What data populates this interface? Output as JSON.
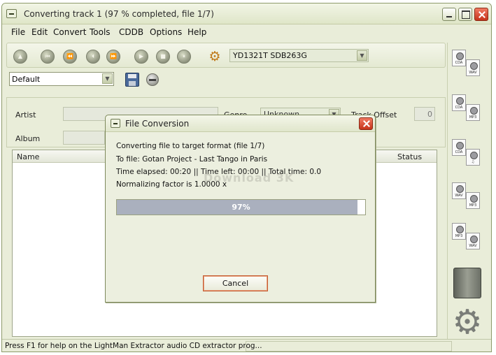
{
  "window": {
    "title": "Converting track 1 (97 % completed, file 1/7)"
  },
  "menu": [
    {
      "label": "File"
    },
    {
      "label": "Edit"
    },
    {
      "label": "Convert"
    },
    {
      "label": "Tools"
    },
    {
      "label": "CDDB"
    },
    {
      "label": "Options"
    },
    {
      "label": "Help"
    }
  ],
  "toolbar": {
    "buttons": [
      {
        "name": "eject-icon",
        "glyph": "▲"
      },
      {
        "name": "previous-track-icon",
        "glyph": "⏮"
      },
      {
        "name": "rewind-icon",
        "glyph": "⏪"
      },
      {
        "name": "skip-back-icon",
        "glyph": "⏴"
      },
      {
        "name": "fast-forward-icon",
        "glyph": "⏩"
      },
      {
        "name": "play-icon",
        "glyph": "▶"
      },
      {
        "name": "stop-icon",
        "glyph": "■"
      },
      {
        "name": "pause-icon",
        "glyph": "⏸"
      }
    ],
    "settings_glyph": "⚙",
    "drive": "YD1321T SDB263G"
  },
  "preset": {
    "value": "Default"
  },
  "info": {
    "artist_label": "Artist",
    "album_label": "Album",
    "genre_label": "Genre",
    "genre_value": "Unknown",
    "track_offset_label": "Track Offset",
    "track_offset_value": "0"
  },
  "track_list": {
    "columns": {
      "name": "Name",
      "status": "Status"
    }
  },
  "right_panel": {
    "conversions": [
      {
        "from": "CDA",
        "to": "WAV"
      },
      {
        "from": "CDA",
        "to": "MP3"
      },
      {
        "from": "CDA",
        "to": "♫"
      },
      {
        "from": "WAV",
        "to": "MP3"
      },
      {
        "from": "MP3",
        "to": "WAV"
      }
    ]
  },
  "status_bar": {
    "text": "Press F1 for help on the LightMan Extractor audio CD extractor prog..."
  },
  "dialog": {
    "title": "File Conversion",
    "line1": "Converting file to target format  (file 1/7)",
    "line2": "To file: Gotan Project - Last Tango in Paris",
    "line3": "Time elapsed: 00:20   ||   Time left: 00:00   ||   Total time:  0.0",
    "line4": "Normalizing factor is  1.0000 x",
    "progress_percent": 97,
    "progress_label": "97%",
    "cancel_label": "Cancel",
    "watermark": "Download 3K"
  },
  "colors": {
    "window_bg": "#e9edd9",
    "progress_fill": "#aab0be",
    "close_red": "#c6331a"
  }
}
